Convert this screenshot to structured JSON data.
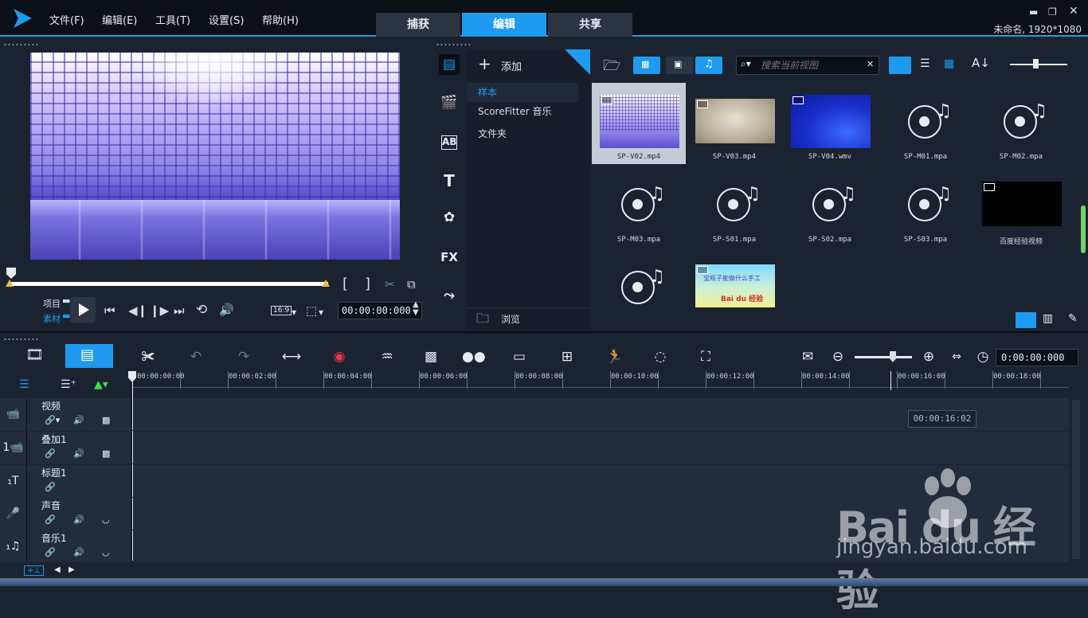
{
  "menu": {
    "file": "文件(F)",
    "edit": "编辑(E)",
    "tools": "工具(T)",
    "settings": "设置(S)",
    "help": "帮助(H)"
  },
  "mode_tabs": {
    "capture": "捕获",
    "edit": "编辑",
    "share": "共享"
  },
  "project_info": "未命名, 1920*1080",
  "preview": {
    "mode_project": "项目",
    "mode_clip": "素材",
    "aspect": "16:9",
    "timecode": "00:00:00:000"
  },
  "library": {
    "add_label": "添加",
    "folders": [
      "样本",
      "ScoreFitter 音乐",
      "文件夹"
    ],
    "browse_label": "浏览",
    "search_placeholder": "搜索当前视图",
    "fx_label": "FX",
    "items": [
      {
        "name": "SP-V02.mp4",
        "kind": "video-dance"
      },
      {
        "name": "SP-V03.mp4",
        "kind": "video-beige"
      },
      {
        "name": "SP-V04.wmv",
        "kind": "video-blue"
      },
      {
        "name": "SP-M01.mpa",
        "kind": "audio"
      },
      {
        "name": "SP-M02.mpa",
        "kind": "audio"
      },
      {
        "name": "SP-M03.mpa",
        "kind": "audio"
      },
      {
        "name": "SP-S01.mpa",
        "kind": "audio"
      },
      {
        "name": "SP-S02.mpa",
        "kind": "audio"
      },
      {
        "name": "SP-S03.mpa",
        "kind": "audio"
      },
      {
        "name": "百度经验视频",
        "kind": "video-black"
      },
      {
        "name": "",
        "kind": "audio"
      },
      {
        "name": "",
        "kind": "video-title"
      }
    ],
    "title_thumb_text": "宝瓶子能做什么手工",
    "title_thumb_logo": "Bai du 经验"
  },
  "timeline": {
    "timecode": "0:00:00:000",
    "ruler_ticks": [
      "00:00:00:00",
      "00:00:02:00",
      "00:00:04:00",
      "00:00:06:00",
      "00:00:08:00",
      "00:00:10:00",
      "00:00:12:00",
      "00:00:14:00",
      "00:00:16:00",
      "00:00:18:00"
    ],
    "hover_time": "00:00:16:02",
    "tracks": [
      {
        "name": "视频",
        "icon": "video-track-icon"
      },
      {
        "name": "叠加1",
        "icon": "overlay-track-icon"
      },
      {
        "name": "标题1",
        "icon": "title-track-icon"
      },
      {
        "name": "声音",
        "icon": "voice-track-icon"
      },
      {
        "name": "音乐1",
        "icon": "music-track-icon"
      }
    ]
  },
  "watermark": {
    "brand": "Bai du 经验",
    "url": "jingyan.baidu.com"
  },
  "colors": {
    "accent": "#1e9bf0",
    "background": "#1b2330",
    "dark": "#0b0f16"
  }
}
